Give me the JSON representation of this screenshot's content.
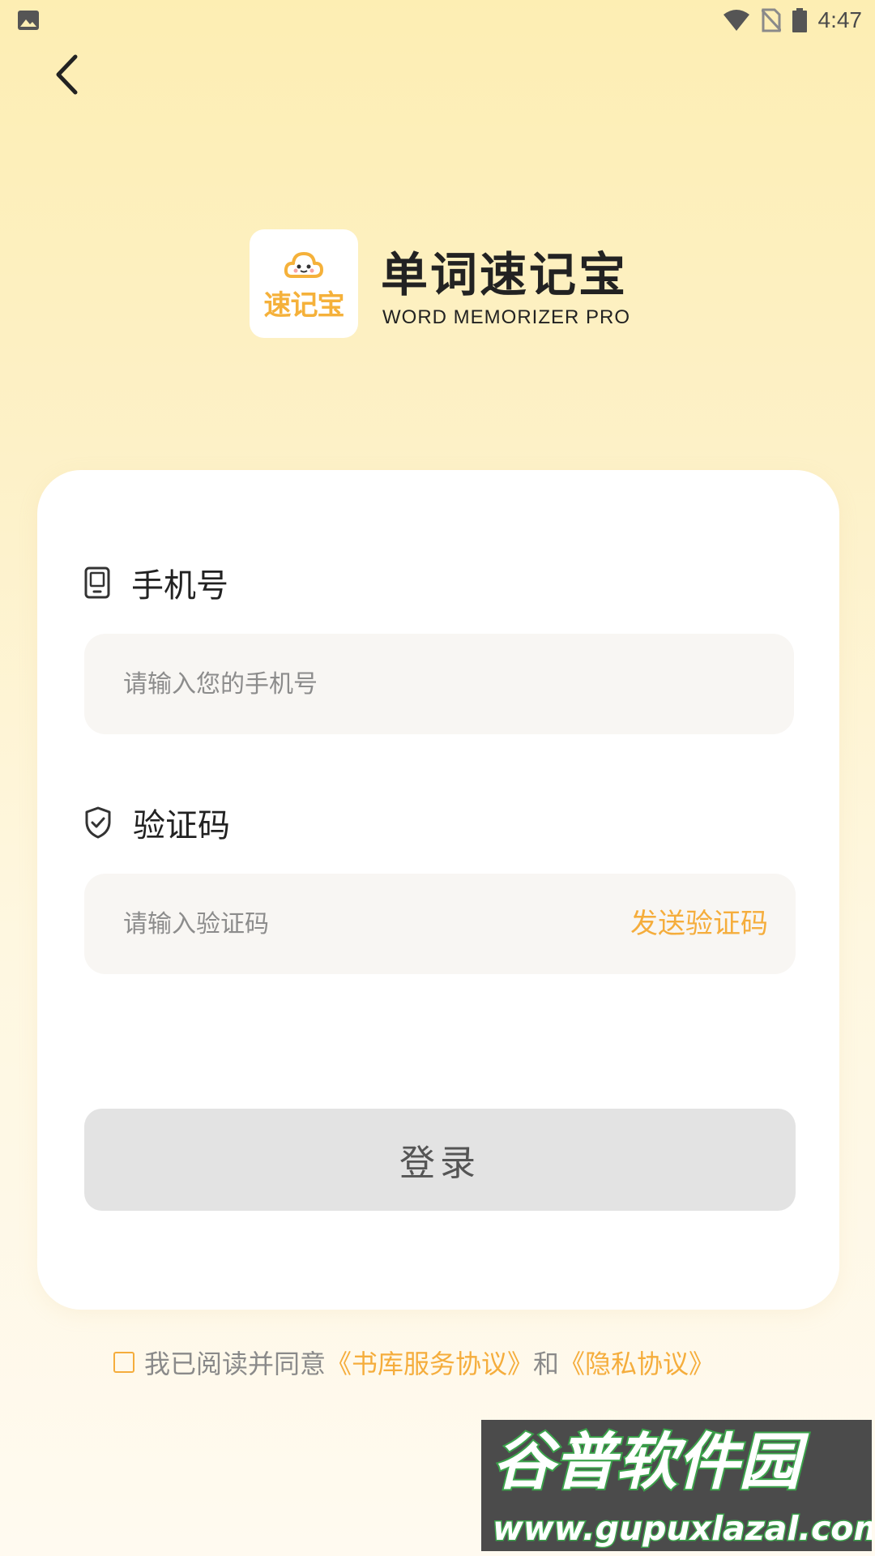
{
  "status_bar": {
    "time": "4:47",
    "icons": [
      "photo-icon",
      "wifi-icon",
      "no-sim-icon",
      "battery-icon"
    ]
  },
  "header": {
    "back_icon": "chevron-left-icon"
  },
  "brand": {
    "logo_text": "速记宝",
    "title": "单词速记宝",
    "subtitle": "WORD MEMORIZER PRO"
  },
  "form": {
    "phone": {
      "label": "手机号",
      "icon": "phone-icon",
      "placeholder": "请输入您的手机号",
      "value": ""
    },
    "code": {
      "label": "验证码",
      "icon": "shield-check-icon",
      "placeholder": "请输入验证码",
      "value": "",
      "send_label": "发送验证码"
    },
    "login_label": "登录"
  },
  "agreement": {
    "checked": false,
    "prefix": "我已阅读并同意",
    "service_link": "《书库服务协议》",
    "conjunction": "和",
    "privacy_link": "《隐私协议》"
  },
  "watermark": {
    "title": "谷普软件园",
    "url": "www.gupuxlazal.com"
  },
  "colors": {
    "accent": "#f5ad3c",
    "background_top": "#fdeeb3",
    "card": "#ffffff",
    "input_bg": "#f8f6f3",
    "button_disabled": "#e3e3e3"
  }
}
